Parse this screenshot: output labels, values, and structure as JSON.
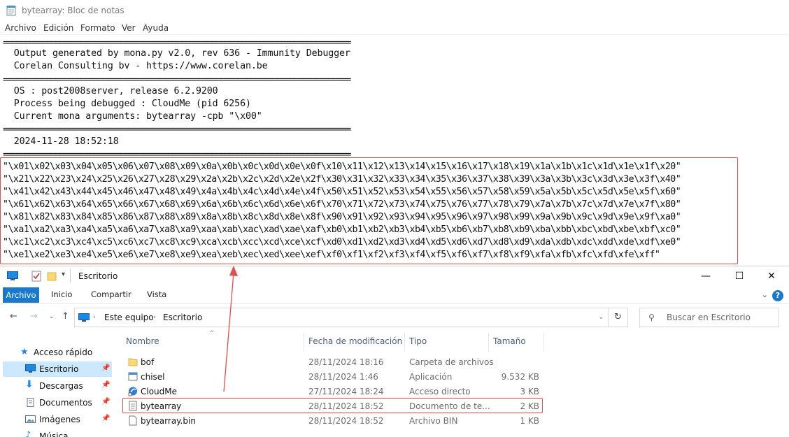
{
  "notepad": {
    "title": "bytearray: Bloc de notas",
    "menu": [
      "Archivo",
      "Edición",
      "Formato",
      "Ver",
      "Ayuda"
    ],
    "lines": [
      "================================================================================",
      "  Output generated by mona.py v2.0, rev 636 - Immunity Debugger",
      "  Corelan Consulting bv - https://www.corelan.be",
      "================================================================================",
      "  OS : post2008server, release 6.2.9200",
      "  Process being debugged : CloudMe (pid 6256)",
      "  Current mona arguments: bytearray -cpb \"\\x00\"",
      "================================================================================",
      "  2024-11-28 18:52:18",
      "================================================================================",
      "\"\\x01\\x02\\x03\\x04\\x05\\x06\\x07\\x08\\x09\\x0a\\x0b\\x0c\\x0d\\x0e\\x0f\\x10\\x11\\x12\\x13\\x14\\x15\\x16\\x17\\x18\\x19\\x1a\\x1b\\x1c\\x1d\\x1e\\x1f\\x20\"",
      "\"\\x21\\x22\\x23\\x24\\x25\\x26\\x27\\x28\\x29\\x2a\\x2b\\x2c\\x2d\\x2e\\x2f\\x30\\x31\\x32\\x33\\x34\\x35\\x36\\x37\\x38\\x39\\x3a\\x3b\\x3c\\x3d\\x3e\\x3f\\x40\"",
      "\"\\x41\\x42\\x43\\x44\\x45\\x46\\x47\\x48\\x49\\x4a\\x4b\\x4c\\x4d\\x4e\\x4f\\x50\\x51\\x52\\x53\\x54\\x55\\x56\\x57\\x58\\x59\\x5a\\x5b\\x5c\\x5d\\x5e\\x5f\\x60\"",
      "\"\\x61\\x62\\x63\\x64\\x65\\x66\\x67\\x68\\x69\\x6a\\x6b\\x6c\\x6d\\x6e\\x6f\\x70\\x71\\x72\\x73\\x74\\x75\\x76\\x77\\x78\\x79\\x7a\\x7b\\x7c\\x7d\\x7e\\x7f\\x80\"",
      "\"\\x81\\x82\\x83\\x84\\x85\\x86\\x87\\x88\\x89\\x8a\\x8b\\x8c\\x8d\\x8e\\x8f\\x90\\x91\\x92\\x93\\x94\\x95\\x96\\x97\\x98\\x99\\x9a\\x9b\\x9c\\x9d\\x9e\\x9f\\xa0\"",
      "\"\\xa1\\xa2\\xa3\\xa4\\xa5\\xa6\\xa7\\xa8\\xa9\\xaa\\xab\\xac\\xad\\xae\\xaf\\xb0\\xb1\\xb2\\xb3\\xb4\\xb5\\xb6\\xb7\\xb8\\xb9\\xba\\xbb\\xbc\\xbd\\xbe\\xbf\\xc0\"",
      "\"\\xc1\\xc2\\xc3\\xc4\\xc5\\xc6\\xc7\\xc8\\xc9\\xca\\xcb\\xcc\\xcd\\xce\\xcf\\xd0\\xd1\\xd2\\xd3\\xd4\\xd5\\xd6\\xd7\\xd8\\xd9\\xda\\xdb\\xdc\\xdd\\xde\\xdf\\xe0\"",
      "\"\\xe1\\xe2\\xe3\\xe4\\xe5\\xe6\\xe7\\xe8\\xe9\\xea\\xeb\\xec\\xed\\xee\\xef\\xf0\\xf1\\xf2\\xf3\\xf4\\xf5\\xf6\\xf7\\xf8\\xf9\\xfa\\xfb\\xfc\\xfd\\xfe\\xff\""
    ]
  },
  "explorer": {
    "title": "Escritorio",
    "ribbon_tabs": [
      "Archivo",
      "Inicio",
      "Compartir",
      "Vista"
    ],
    "help": "?",
    "address": [
      "Este equipo",
      "Escritorio"
    ],
    "search_placeholder": "Buscar en Escritorio",
    "sidebar": [
      {
        "label": "Acceso rápido",
        "icon": "star-icon",
        "pinned": false
      },
      {
        "label": "Escritorio",
        "icon": "desktop-icon",
        "pinned": true
      },
      {
        "label": "Descargas",
        "icon": "download-icon",
        "pinned": true
      },
      {
        "label": "Documentos",
        "icon": "documents-icon",
        "pinned": true
      },
      {
        "label": "Imágenes",
        "icon": "images-icon",
        "pinned": true
      },
      {
        "label": "Música",
        "icon": "music-icon",
        "pinned": false
      }
    ],
    "columns": [
      "Nombre",
      "Fecha de modificación",
      "Tipo",
      "Tamaño"
    ],
    "files": [
      {
        "name": "bof",
        "date": "28/11/2024 18:16",
        "type": "Carpeta de archivos",
        "size": "",
        "icon": "folder-icon"
      },
      {
        "name": "chisel",
        "date": "28/11/2024 1:46",
        "type": "Aplicación",
        "size": "9.532 KB",
        "icon": "application-icon"
      },
      {
        "name": "CloudMe",
        "date": "27/11/2024 18:24",
        "type": "Acceso directo",
        "size": "3 KB",
        "icon": "shortcut-icon"
      },
      {
        "name": "bytearray",
        "date": "28/11/2024 18:52",
        "type": "Documento de te...",
        "size": "2 KB",
        "icon": "text-file-icon"
      },
      {
        "name": "bytearray.bin",
        "date": "28/11/2024 18:52",
        "type": "Archivo BIN",
        "size": "1 KB",
        "icon": "file-icon"
      }
    ]
  },
  "colors": {
    "accent": "#1979ca",
    "annotation": "#e34d4d",
    "selected": "#cce8ff"
  }
}
